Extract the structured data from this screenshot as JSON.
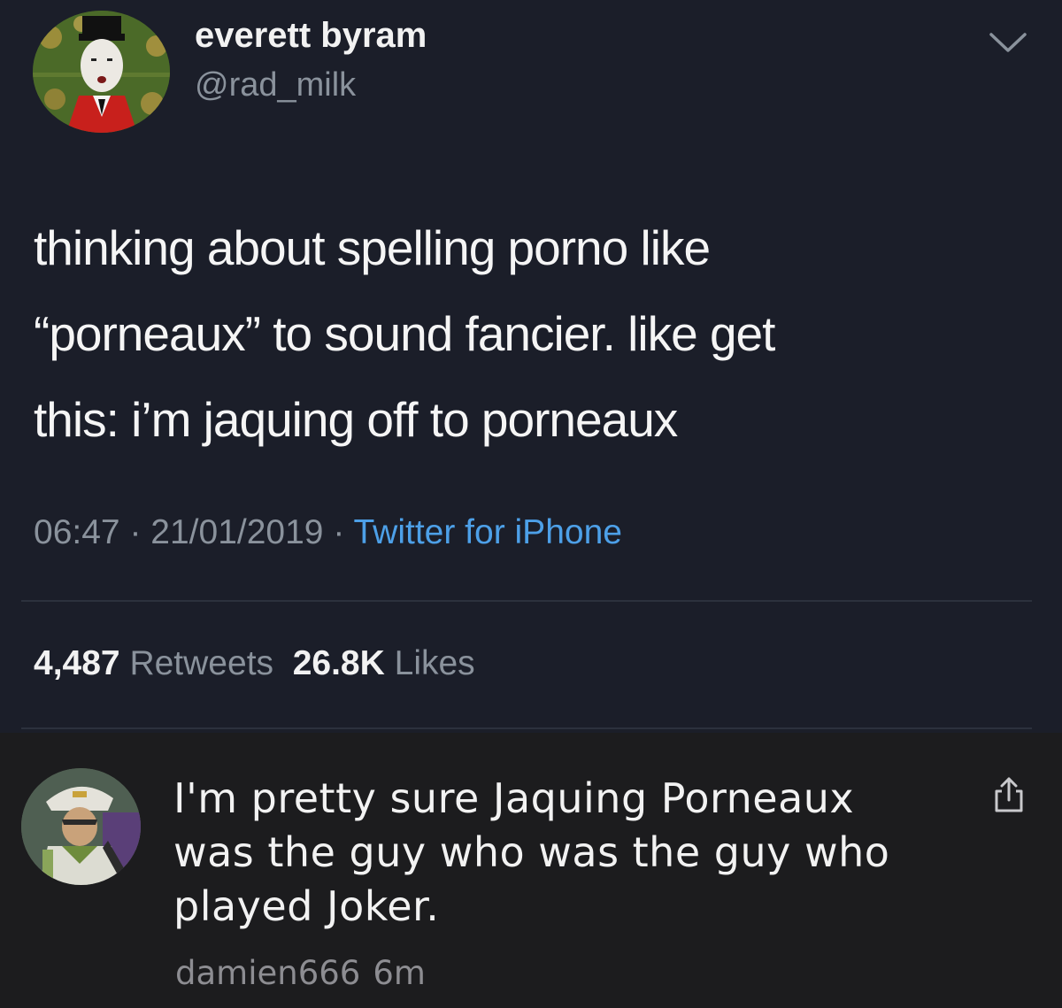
{
  "tweet": {
    "author": {
      "display_name": "everett byram",
      "handle": "@rad_milk"
    },
    "text_lines": [
      "thinking about spelling porno like",
      "“porneaux” to sound fancier. like get",
      "this: i’m jaquing off to porneaux"
    ],
    "time": "06:47",
    "separator": "·",
    "date": "21/01/2019",
    "source": "Twitter for iPhone",
    "retweets_count": "4,487",
    "retweets_label": "Retweets",
    "likes_count": "26.8K",
    "likes_label": "Likes",
    "icons": {
      "menu": "chevron-down-icon"
    }
  },
  "reply": {
    "text_lines": [
      "I'm pretty sure Jaquing Porneaux",
      "was the guy who was the guy who",
      "played Joker."
    ],
    "username": "damien666",
    "time": "6m",
    "icons": {
      "share": "share-icon"
    }
  },
  "colors": {
    "tweet_background": "#1b1e29",
    "reply_background": "#1c1c1e",
    "primary_text": "#f5f5f5",
    "secondary_text": "#8a929c",
    "link": "#4da0e8"
  }
}
